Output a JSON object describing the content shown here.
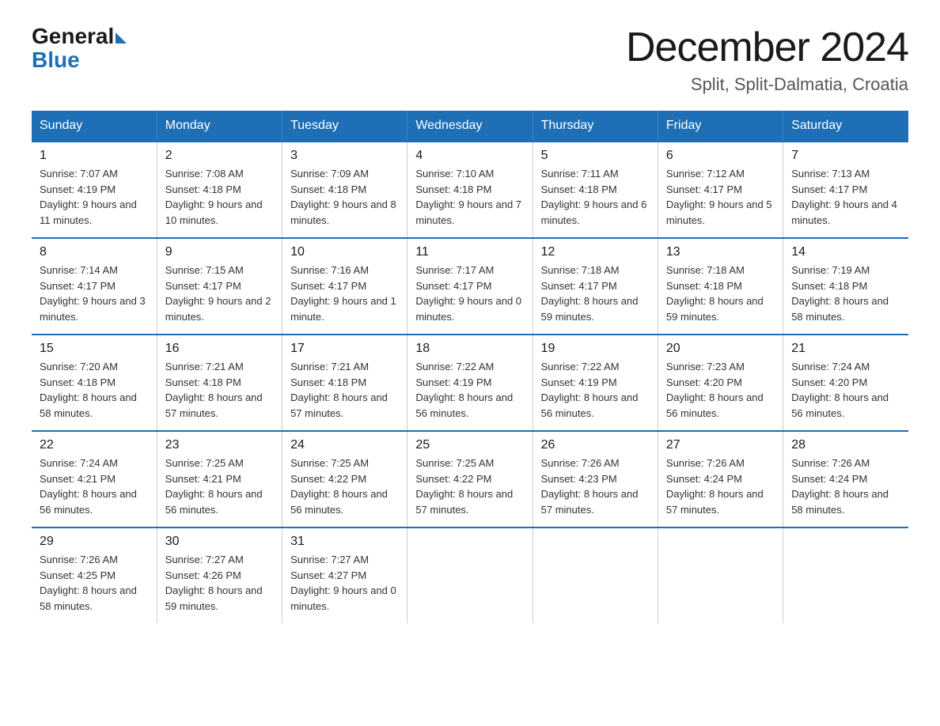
{
  "logo": {
    "general": "General",
    "blue": "Blue"
  },
  "calendar": {
    "title": "December 2024",
    "subtitle": "Split, Split-Dalmatia, Croatia"
  },
  "headers": [
    "Sunday",
    "Monday",
    "Tuesday",
    "Wednesday",
    "Thursday",
    "Friday",
    "Saturday"
  ],
  "weeks": [
    [
      {
        "day": "1",
        "sunrise": "7:07 AM",
        "sunset": "4:19 PM",
        "daylight": "9 hours and 11 minutes."
      },
      {
        "day": "2",
        "sunrise": "7:08 AM",
        "sunset": "4:18 PM",
        "daylight": "9 hours and 10 minutes."
      },
      {
        "day": "3",
        "sunrise": "7:09 AM",
        "sunset": "4:18 PM",
        "daylight": "9 hours and 8 minutes."
      },
      {
        "day": "4",
        "sunrise": "7:10 AM",
        "sunset": "4:18 PM",
        "daylight": "9 hours and 7 minutes."
      },
      {
        "day": "5",
        "sunrise": "7:11 AM",
        "sunset": "4:18 PM",
        "daylight": "9 hours and 6 minutes."
      },
      {
        "day": "6",
        "sunrise": "7:12 AM",
        "sunset": "4:17 PM",
        "daylight": "9 hours and 5 minutes."
      },
      {
        "day": "7",
        "sunrise": "7:13 AM",
        "sunset": "4:17 PM",
        "daylight": "9 hours and 4 minutes."
      }
    ],
    [
      {
        "day": "8",
        "sunrise": "7:14 AM",
        "sunset": "4:17 PM",
        "daylight": "9 hours and 3 minutes."
      },
      {
        "day": "9",
        "sunrise": "7:15 AM",
        "sunset": "4:17 PM",
        "daylight": "9 hours and 2 minutes."
      },
      {
        "day": "10",
        "sunrise": "7:16 AM",
        "sunset": "4:17 PM",
        "daylight": "9 hours and 1 minute."
      },
      {
        "day": "11",
        "sunrise": "7:17 AM",
        "sunset": "4:17 PM",
        "daylight": "9 hours and 0 minutes."
      },
      {
        "day": "12",
        "sunrise": "7:18 AM",
        "sunset": "4:17 PM",
        "daylight": "8 hours and 59 minutes."
      },
      {
        "day": "13",
        "sunrise": "7:18 AM",
        "sunset": "4:18 PM",
        "daylight": "8 hours and 59 minutes."
      },
      {
        "day": "14",
        "sunrise": "7:19 AM",
        "sunset": "4:18 PM",
        "daylight": "8 hours and 58 minutes."
      }
    ],
    [
      {
        "day": "15",
        "sunrise": "7:20 AM",
        "sunset": "4:18 PM",
        "daylight": "8 hours and 58 minutes."
      },
      {
        "day": "16",
        "sunrise": "7:21 AM",
        "sunset": "4:18 PM",
        "daylight": "8 hours and 57 minutes."
      },
      {
        "day": "17",
        "sunrise": "7:21 AM",
        "sunset": "4:18 PM",
        "daylight": "8 hours and 57 minutes."
      },
      {
        "day": "18",
        "sunrise": "7:22 AM",
        "sunset": "4:19 PM",
        "daylight": "8 hours and 56 minutes."
      },
      {
        "day": "19",
        "sunrise": "7:22 AM",
        "sunset": "4:19 PM",
        "daylight": "8 hours and 56 minutes."
      },
      {
        "day": "20",
        "sunrise": "7:23 AM",
        "sunset": "4:20 PM",
        "daylight": "8 hours and 56 minutes."
      },
      {
        "day": "21",
        "sunrise": "7:24 AM",
        "sunset": "4:20 PM",
        "daylight": "8 hours and 56 minutes."
      }
    ],
    [
      {
        "day": "22",
        "sunrise": "7:24 AM",
        "sunset": "4:21 PM",
        "daylight": "8 hours and 56 minutes."
      },
      {
        "day": "23",
        "sunrise": "7:25 AM",
        "sunset": "4:21 PM",
        "daylight": "8 hours and 56 minutes."
      },
      {
        "day": "24",
        "sunrise": "7:25 AM",
        "sunset": "4:22 PM",
        "daylight": "8 hours and 56 minutes."
      },
      {
        "day": "25",
        "sunrise": "7:25 AM",
        "sunset": "4:22 PM",
        "daylight": "8 hours and 57 minutes."
      },
      {
        "day": "26",
        "sunrise": "7:26 AM",
        "sunset": "4:23 PM",
        "daylight": "8 hours and 57 minutes."
      },
      {
        "day": "27",
        "sunrise": "7:26 AM",
        "sunset": "4:24 PM",
        "daylight": "8 hours and 57 minutes."
      },
      {
        "day": "28",
        "sunrise": "7:26 AM",
        "sunset": "4:24 PM",
        "daylight": "8 hours and 58 minutes."
      }
    ],
    [
      {
        "day": "29",
        "sunrise": "7:26 AM",
        "sunset": "4:25 PM",
        "daylight": "8 hours and 58 minutes."
      },
      {
        "day": "30",
        "sunrise": "7:27 AM",
        "sunset": "4:26 PM",
        "daylight": "8 hours and 59 minutes."
      },
      {
        "day": "31",
        "sunrise": "7:27 AM",
        "sunset": "4:27 PM",
        "daylight": "9 hours and 0 minutes."
      },
      null,
      null,
      null,
      null
    ]
  ]
}
